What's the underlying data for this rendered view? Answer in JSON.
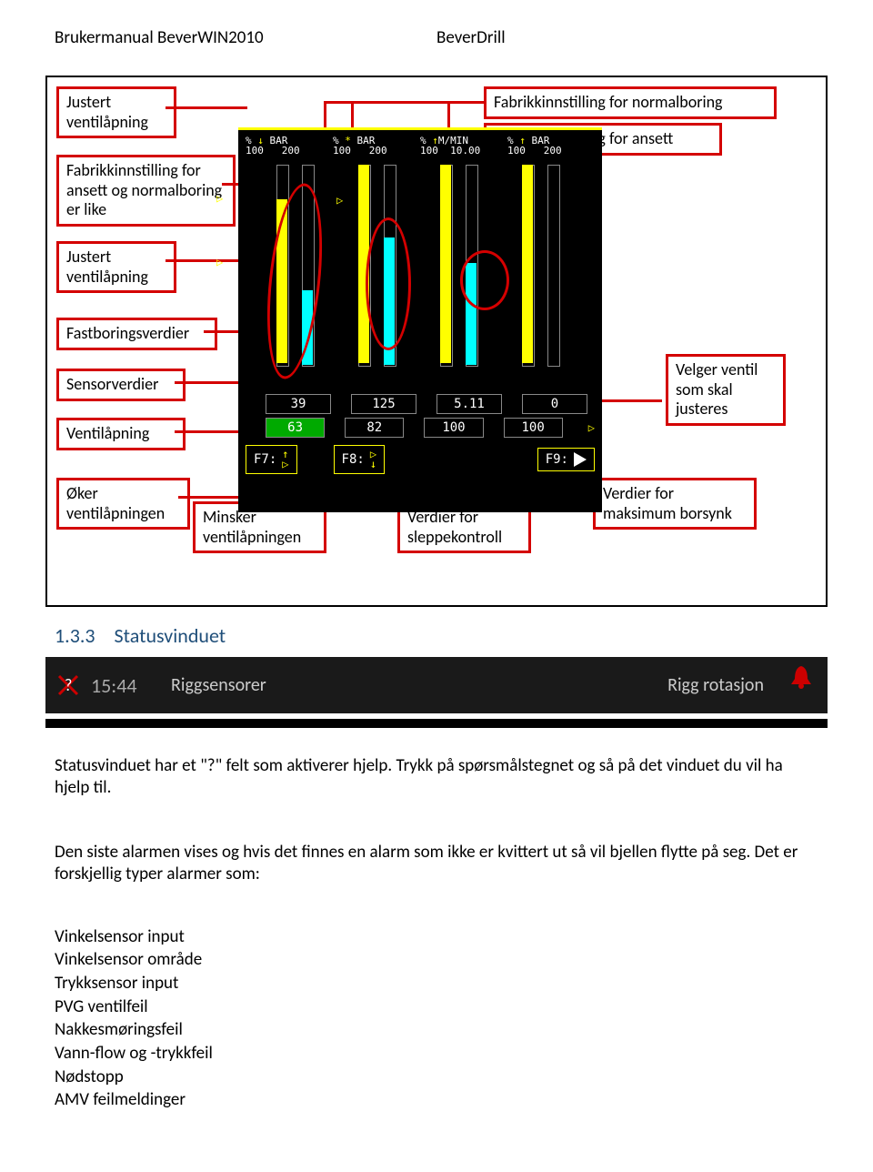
{
  "header": {
    "left": "Brukermanual BeverWIN2010",
    "right": "BeverDrill"
  },
  "labels": {
    "l1": "Justert ventilåpning",
    "l2": "Fabrikkinnstilling for ansett og normalboring er like",
    "l3": "Justert ventilåpning",
    "l4": "Fastboringsverdier",
    "l5": "Sensorverdier",
    "l6": "Ventilåpning",
    "l7": "Øker ventilåpningen",
    "l8": "Minsker ventilåpningen",
    "l9": "Verdier for sleppekontroll",
    "l10": "Verdier for maksimum borsynk",
    "l11": "Velger ventil som skal justeres",
    "l12": "Fabrikkinnstilling for normalboring",
    "l13": "Fabrikkinnstilling for ansett"
  },
  "screenshot": {
    "headers": [
      {
        "pct": "%",
        "n1": "100",
        "u": "BAR",
        "n2": "200",
        "icon": "down"
      },
      {
        "pct": "%",
        "n1": "100",
        "u": "BAR",
        "n2": "200",
        "icon": "dot"
      },
      {
        "pct": "%",
        "n1": "100",
        "u": "M/MIN",
        "n2": "10.00",
        "icon": "up"
      },
      {
        "pct": "%",
        "n1": "100",
        "u": "BAR",
        "n2": "200",
        "icon": "up"
      }
    ],
    "row1": [
      "39",
      "125",
      "5.11",
      "0"
    ],
    "row2": [
      "63",
      "82",
      "100",
      "100"
    ],
    "fkeys": {
      "f7": "F7:",
      "f8": "F8:",
      "f9": "F9:"
    }
  },
  "section": {
    "num": "1.3.3",
    "title": "Statusvinduet"
  },
  "status_bar": {
    "time": "15:44",
    "text1": "Riggsensorer",
    "text2": "Rigg rotasjon"
  },
  "paragraphs": {
    "p1": "Statusvinduet har et \"?\" felt som aktiverer hjelp. Trykk på spørsmålstegnet og så på det vinduet du vil ha hjelp til.",
    "p2": "Den siste alarmen vises og hvis det finnes en alarm som ikke er kvittert ut så vil bjellen flytte på seg. Det er forskjellig typer alarmer som:"
  },
  "list": [
    "Vinkelsensor input",
    "Vinkelsensor område",
    "Trykksensor input",
    "PVG ventilfeil",
    "Nakkesmøringsfeil",
    "Vann-flow og -trykkfeil",
    "Nødstopp",
    "AMV feilmeldinger"
  ]
}
